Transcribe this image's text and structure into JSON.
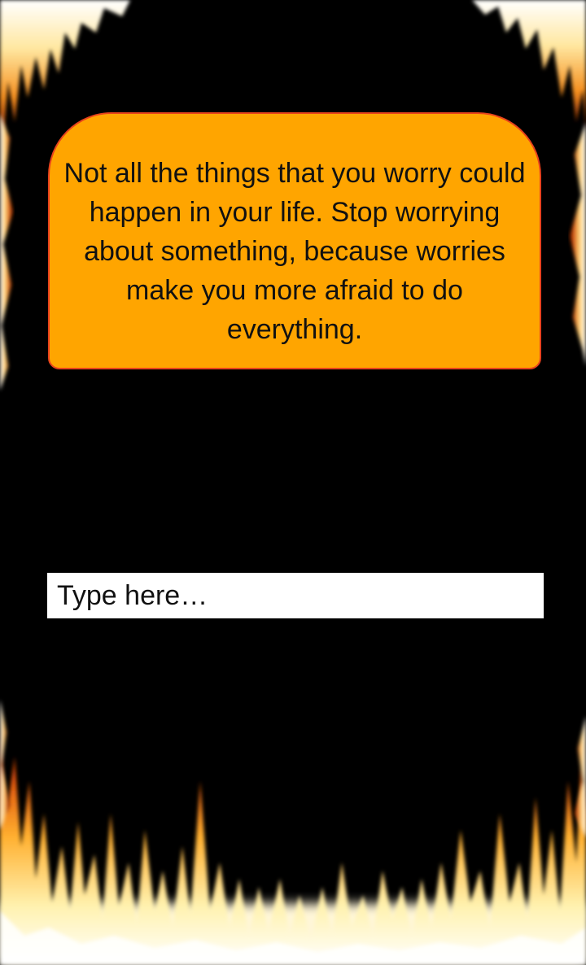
{
  "quote": {
    "text": "Not all the things that you worry could happen in your life. Stop worrying about something, because worries make you more afraid to do everything."
  },
  "input": {
    "placeholder": "Type here…",
    "value": ""
  },
  "theme": {
    "background": "#000000",
    "card_fill": "#FFA500",
    "card_border": "#E8421C",
    "input_fill": "#FFFFFF",
    "text": "#111111",
    "flame_colors": [
      "#FFFFFF",
      "#FFF2B0",
      "#FFB030",
      "#E0520A",
      "#8A1A00"
    ]
  },
  "decorations": {
    "border_icon": "flame-border-icon"
  }
}
